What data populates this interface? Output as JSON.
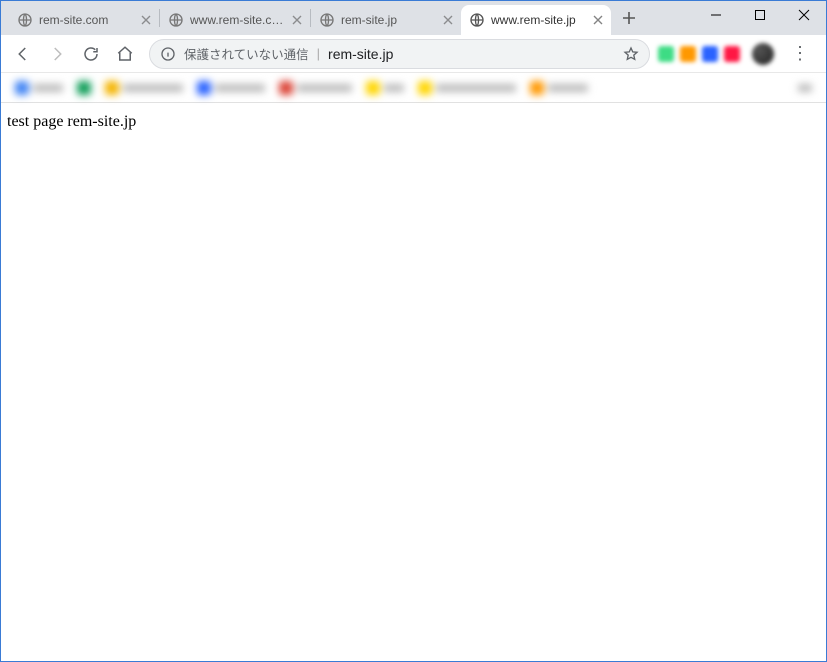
{
  "window_controls": {
    "minimize": "minimize",
    "maximize": "maximize",
    "close": "close"
  },
  "tabs": [
    {
      "title": "rem-site.com",
      "active": false
    },
    {
      "title": "www.rem-site.c…",
      "active": false
    },
    {
      "title": "rem-site.jp",
      "active": false
    },
    {
      "title": "www.rem-site.jp",
      "active": true
    }
  ],
  "newtab_label": "+",
  "nav": {
    "back": "back",
    "forward": "forward",
    "reload": "reload",
    "home": "home"
  },
  "omnibox": {
    "security_text": "保護されていない通信",
    "url": "rem-site.jp"
  },
  "extension_colors": [
    "#3ddc84",
    "#ff9800",
    "#2962ff",
    "#ff1744",
    "#ffd600",
    "#ffd600",
    "#ff9800"
  ],
  "page": {
    "body_text": "test page rem-site.jp"
  }
}
